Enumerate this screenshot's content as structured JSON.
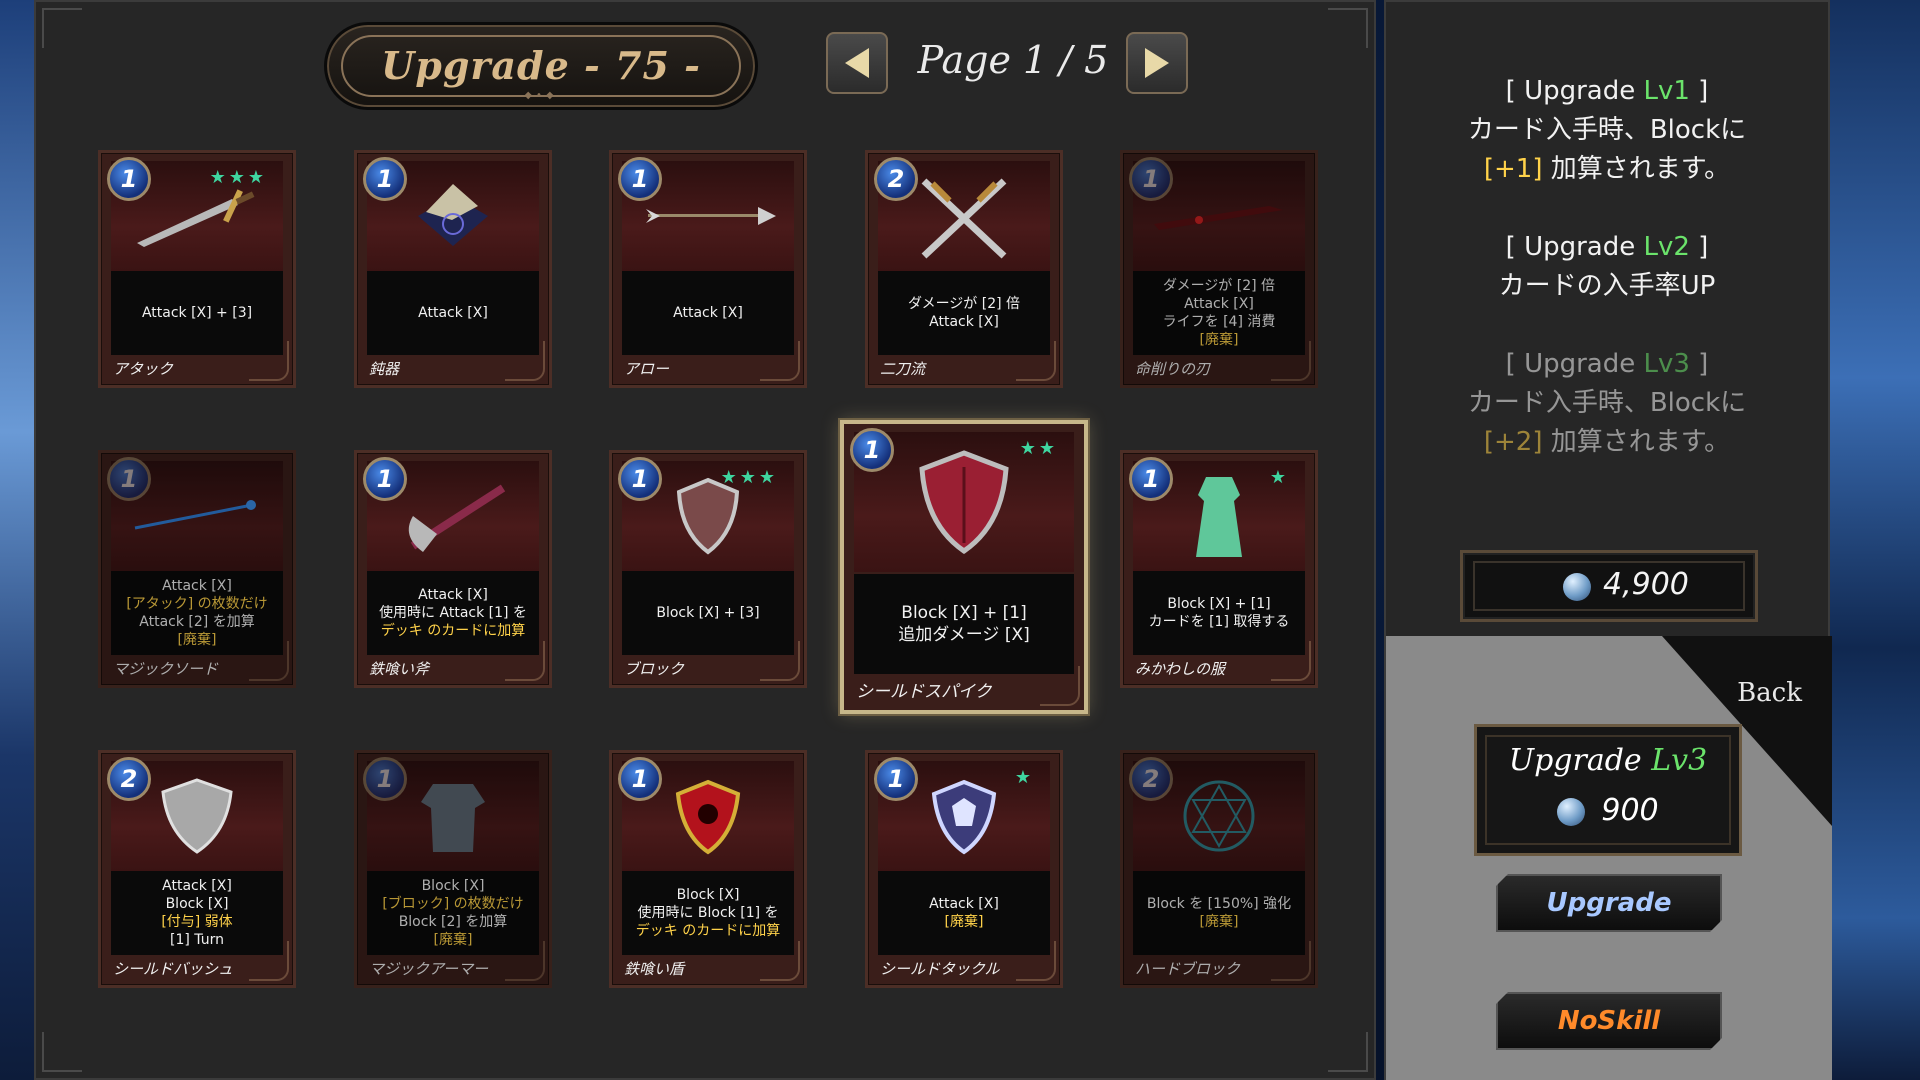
{
  "header": {
    "title": "Upgrade - 75 -",
    "page": "Page 1 / 5"
  },
  "cards": [
    {
      "cost": "1",
      "stars": "★★★",
      "desc": [
        "Attack [X] + [3]"
      ],
      "name": "アタック"
    },
    {
      "cost": "1",
      "stars": "",
      "desc": [
        "Attack [X]"
      ],
      "name": "鈍器"
    },
    {
      "cost": "1",
      "stars": "",
      "desc": [
        "Attack [X]"
      ],
      "name": "アロー"
    },
    {
      "cost": "2",
      "stars": "",
      "desc": [
        "ダメージが [2] 倍",
        "Attack [X]"
      ],
      "name": "二刀流"
    },
    {
      "cost": "1",
      "stars": "",
      "desc": [
        "ダメージが [2] 倍",
        "Attack [X]",
        "ライフを [4] 消費",
        "[廃棄]"
      ],
      "name": "命削りの刃"
    },
    {
      "cost": "1",
      "stars": "",
      "desc": [
        "Attack [X]",
        "[アタック] の枚数だけ",
        "Attack [2] を加算",
        "[廃棄]"
      ],
      "name": "マジックソード"
    },
    {
      "cost": "1",
      "stars": "",
      "desc": [
        "Attack [X]",
        "使用時に Attack [1] を",
        "デッキ のカードに加算"
      ],
      "name": "鉄喰い斧"
    },
    {
      "cost": "1",
      "stars": "★★★",
      "desc": [
        "Block [X] + [3]"
      ],
      "name": "ブロック"
    },
    {
      "cost": "1",
      "stars": "★★",
      "desc": [
        "Block [X] + [1]",
        "追加ダメージ [X]"
      ],
      "name": "シールドスパイク"
    },
    {
      "cost": "1",
      "stars": "★",
      "desc": [
        "Block [X] + [1]",
        "カードを [1] 取得する"
      ],
      "name": "みかわしの服"
    },
    {
      "cost": "2",
      "stars": "",
      "desc": [
        "Attack [X]",
        "Block [X]",
        "[付与] 弱体",
        "[1] Turn"
      ],
      "name": "シールドバッシュ"
    },
    {
      "cost": "1",
      "stars": "",
      "desc": [
        "Block [X]",
        "[ブロック] の枚数だけ",
        "Block [2] を加算",
        "[廃棄]"
      ],
      "name": "マジックアーマー"
    },
    {
      "cost": "1",
      "stars": "",
      "desc": [
        "Block [X]",
        "使用時に Block [1] を",
        "デッキ のカードに加算"
      ],
      "name": "鉄喰い盾"
    },
    {
      "cost": "1",
      "stars": "★",
      "desc": [
        "Attack [X]",
        "[廃棄]"
      ],
      "name": "シールドタックル"
    },
    {
      "cost": "2",
      "stars": "",
      "desc": [
        "Block を [150%] 強化",
        "[廃棄]"
      ],
      "name": "ハードブロック"
    }
  ],
  "side": {
    "lv1_head": "[ Upgrade ",
    "lv1_lvl": "Lv1",
    "lv1_tail": " ]",
    "lv1_line1": "カード入手時、Blockに",
    "lv1_plus": "[+1]",
    "lv1_line2": " 加算されます。",
    "lv2_head": "[ Upgrade ",
    "lv2_lvl": "Lv2",
    "lv2_tail": " ]",
    "lv2_line1": "カードの入手率UP",
    "lv3_head": "[ Upgrade ",
    "lv3_lvl": "Lv3",
    "lv3_tail": " ]",
    "lv3_line1": "カード入手時、Blockに",
    "lv3_plus": "[+2]",
    "lv3_line2": " 加算されます。",
    "money": "4,900",
    "back": "Back",
    "upgrade_title": "Upgrade ",
    "upgrade_lvl": "Lv3",
    "upgrade_cost": "900",
    "upgrade_btn": "Upgrade",
    "noskill_btn": "NoSkill"
  },
  "colors": {
    "level_green": "#6be36b",
    "highlight_yellow": "#ffd24a",
    "star_teal": "#3fd6a0"
  }
}
